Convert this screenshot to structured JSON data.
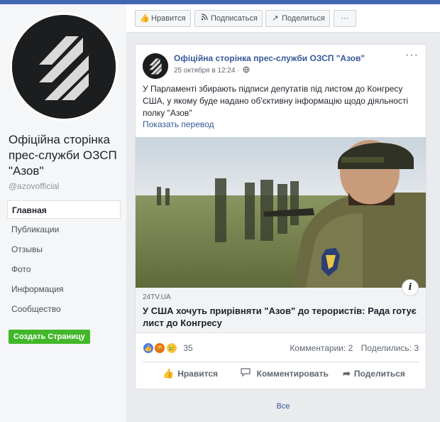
{
  "page": {
    "name": "Офіційна сторінка прес-служби ОЗСП \"Азов\"",
    "handle": "@azovofficial"
  },
  "nav": {
    "items": [
      {
        "label": "Главная",
        "active": true
      },
      {
        "label": "Публикации"
      },
      {
        "label": "Отзывы"
      },
      {
        "label": "Фото"
      },
      {
        "label": "Информация"
      },
      {
        "label": "Сообщество"
      }
    ],
    "create_page": "Создать Страницу"
  },
  "actionbar": {
    "like": "Нравится",
    "subscribe": "Подписаться",
    "share": "Поделиться",
    "more": "···"
  },
  "post": {
    "author": "Офіційна сторінка прес-служби ОЗСП \"Азов\"",
    "date": "25 октября в 12:24 ·",
    "more": "···",
    "text": "У Парламенті збирають підписи депутатів під листом до Конгресу США, у якому буде надано об'єктивну інформацію щодо діяльності полку \"Азов\"",
    "translate": "Показать перевод",
    "link": {
      "domain": "24TV.UA",
      "title": "У США хочуть прирівняти \"Азов\" до терористів: Рада готує лист до Конгресу",
      "info_icon": "i"
    },
    "reactions": {
      "count": "35"
    },
    "stats": {
      "comments": "Комментарии: 2",
      "shares": "Поделились: 3"
    },
    "actions": {
      "like": "Нравится",
      "comment": "Комментировать",
      "share": "Поделиться"
    }
  },
  "see_all": "Все",
  "colors": {
    "brand_blue": "#4267b2",
    "link_blue": "#385898",
    "create_green": "#42b72a"
  },
  "icons": [
    "thumbs-up-icon",
    "rss-icon",
    "share-arrow-icon",
    "globe-icon",
    "comment-icon",
    "info-icon"
  ]
}
